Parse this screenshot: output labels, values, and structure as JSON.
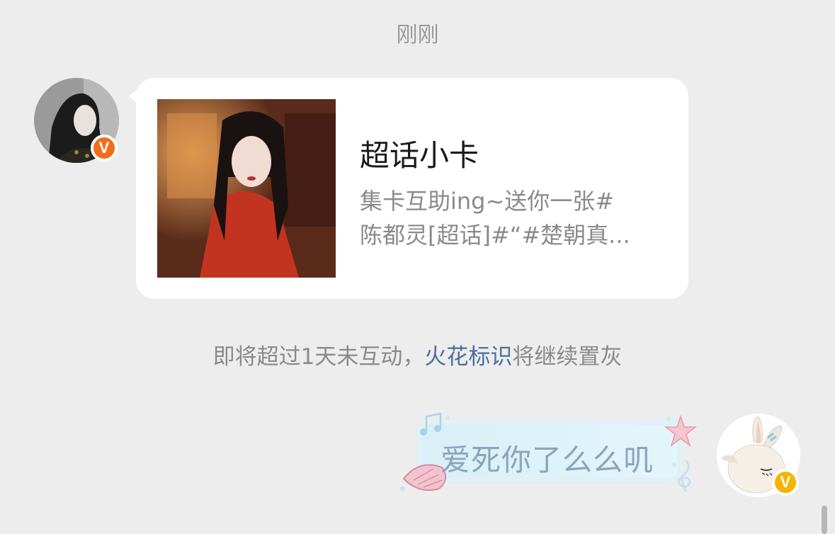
{
  "timestamp": "刚刚",
  "incoming_message": {
    "card_title": "超话小卡",
    "card_desc_line1": "集卡互助ing~送你一张#",
    "card_desc_line2": "陈都灵[超话]#“#楚朝真..."
  },
  "notice": {
    "prefix": "即将超过1天未互动，",
    "link": "火花标识",
    "suffix": "将继续置灰"
  },
  "outgoing_message": {
    "text": "爱死你了么么叽"
  },
  "badges": {
    "left_label": "V",
    "right_label": "V"
  },
  "colors": {
    "background": "#ededed",
    "link": "#4a6f9e",
    "badge_orange": "#f26c1a",
    "badge_yellow": "#f5b400"
  }
}
